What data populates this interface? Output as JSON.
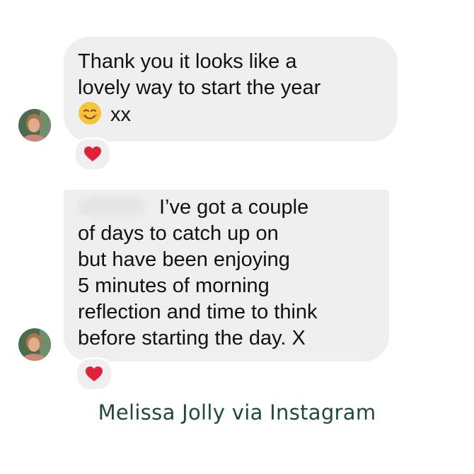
{
  "messages": [
    {
      "lines": [
        "Thank you it looks like a",
        "lovely way to start the year"
      ],
      "emoji_name": "smiling-face-with-smiling-eyes-emoji",
      "tail_text": "xx",
      "reaction_icon": "heart-icon"
    },
    {
      "lines": [
        "I’ve got a couple",
        "of days to catch up on",
        "but have been enjoying",
        "5 minutes of morning",
        "reflection and time to think",
        "before starting the day. X"
      ],
      "reaction_icon": "heart-icon"
    }
  ],
  "caption": "Melissa Jolly via Instagram",
  "colors": {
    "bubble": "#efefef",
    "heart": "#e0223a",
    "caption": "#1f4a3e"
  }
}
